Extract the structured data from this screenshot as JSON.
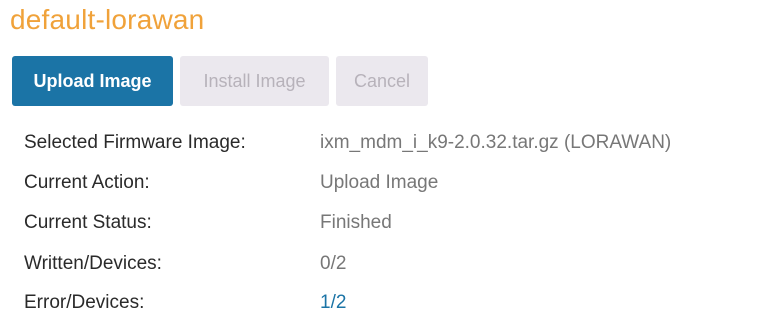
{
  "title": "default-lorawan",
  "buttons": {
    "upload": "Upload Image",
    "install": "Install Image",
    "cancel": "Cancel"
  },
  "details": {
    "selected_firmware": {
      "label": "Selected Firmware Image:",
      "value": "ixm_mdm_i_k9-2.0.32.tar.gz (LORAWAN)"
    },
    "current_action": {
      "label": "Current Action:",
      "value": "Upload Image"
    },
    "current_status": {
      "label": "Current Status:",
      "value": "Finished"
    },
    "written_devices": {
      "label": "Written/Devices:",
      "value": "0/2"
    },
    "error_devices": {
      "label": "Error/Devices:",
      "value": "1/2"
    }
  },
  "colors": {
    "title": "#f0a23a",
    "primary_button": "#1b74a6",
    "disabled_button": "#ebe8ee",
    "link": "#1b74a6"
  }
}
